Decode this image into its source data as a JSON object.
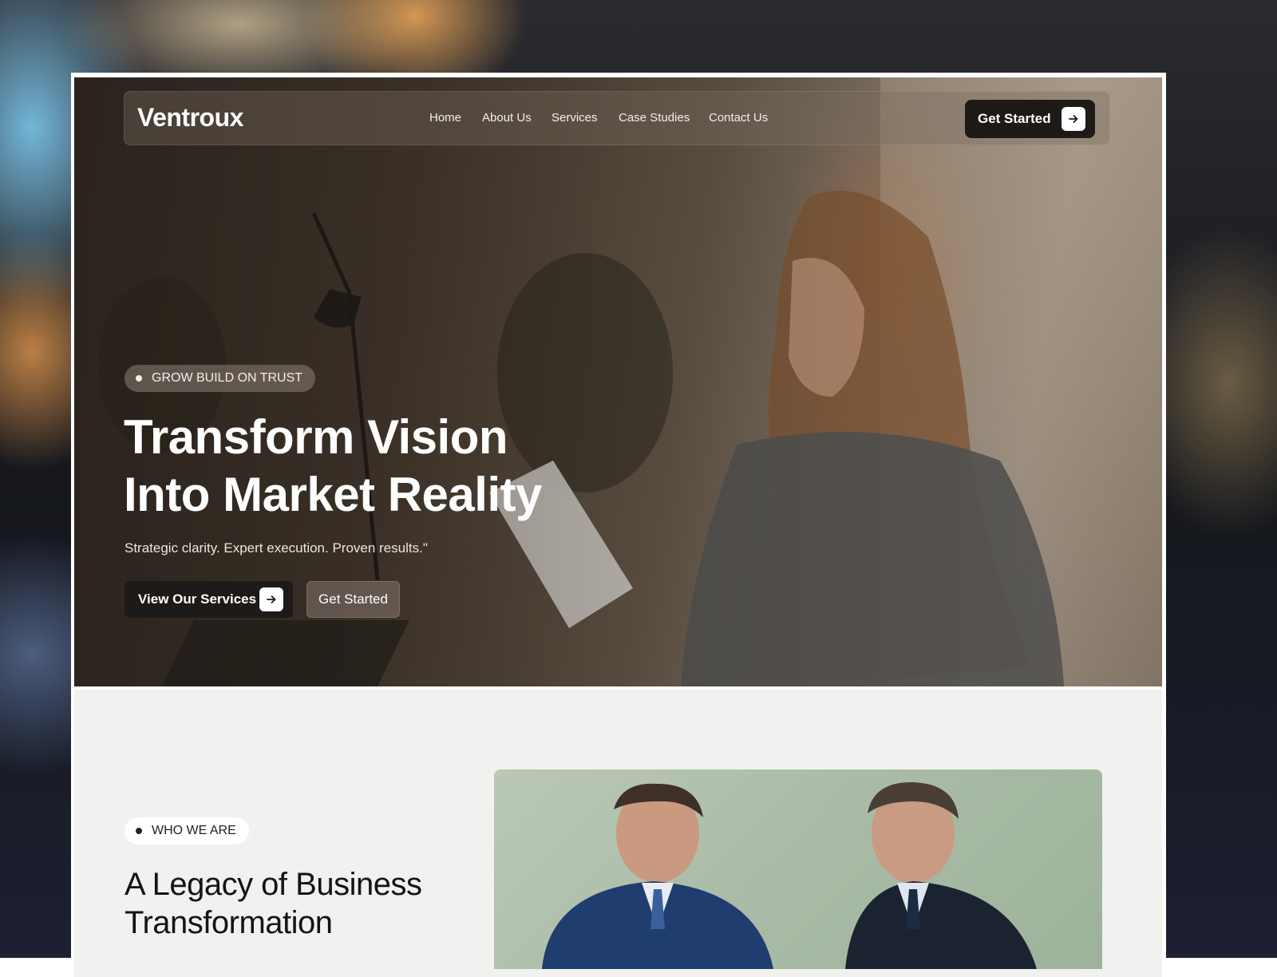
{
  "nav": {
    "logo": "Ventroux",
    "links": [
      {
        "label": "Home"
      },
      {
        "label": "About Us"
      },
      {
        "label": "Services"
      },
      {
        "label": "Case Studies"
      },
      {
        "label": "Contact Us"
      }
    ],
    "cta_label": "Get Started",
    "cta_icon": "arrow-right-icon"
  },
  "hero": {
    "badge": "GROW BUILD ON TRUST",
    "title_line1": "Transform Vision",
    "title_line2": "Into Market Reality",
    "subtitle": "Strategic clarity. Expert execution. Proven results.\"",
    "primary_button": "View Our Services",
    "primary_icon": "arrow-right-icon",
    "secondary_button": "Get Started"
  },
  "about": {
    "badge": "WHO WE ARE",
    "title_line1": "A Legacy of Business",
    "title_line2": "Transformation"
  },
  "colors": {
    "dark_button": "#1d1a17",
    "white": "#ffffff",
    "section_bg": "#f1f1f0",
    "image_bg": "#b9c8b5"
  }
}
